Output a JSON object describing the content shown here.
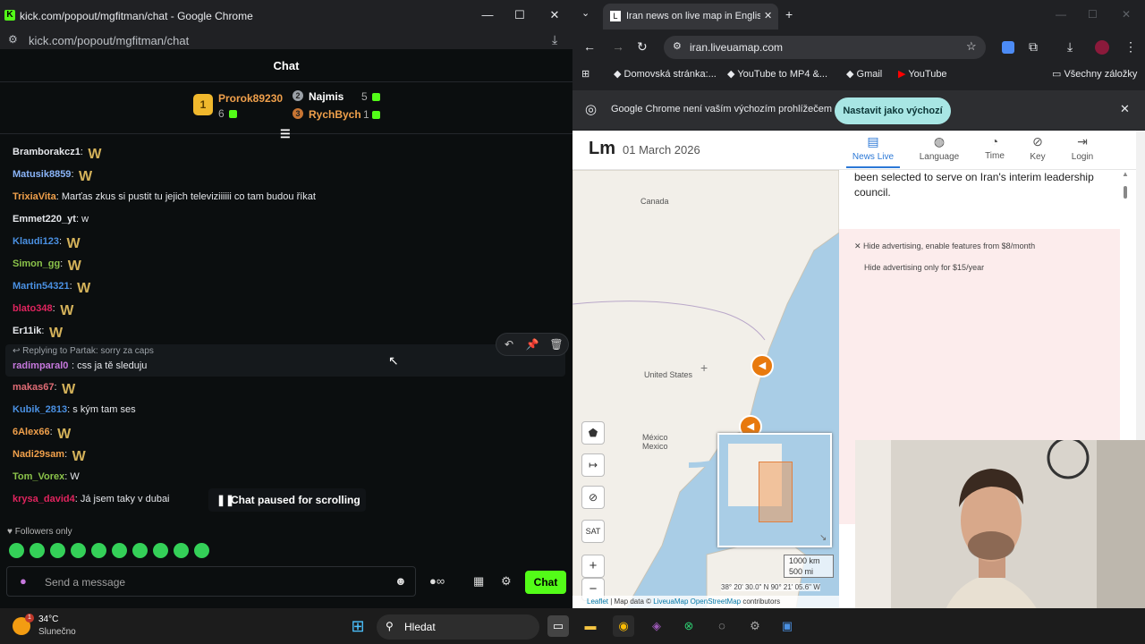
{
  "left_window": {
    "title": "kick.com/popout/mgfitman/chat - Google Chrome",
    "url": "kick.com/popout/mgfitman/chat",
    "chat_header": "Chat",
    "leaderboard": {
      "first": {
        "rank": "1",
        "name": "Prorok89230",
        "count": "6"
      },
      "second": {
        "rank": "2",
        "name": "Najmis",
        "count": "5"
      },
      "third": {
        "rank": "3",
        "name": "RychBych",
        "count": "1"
      }
    },
    "messages": [
      {
        "user": "Bramborakcz1",
        "color": "#e5e7eb",
        "text": ""
      },
      {
        "user": "Matusik8859",
        "color": "#8ab4f8",
        "text": ""
      },
      {
        "user": "TrixiaVita",
        "color": "#f0a04b",
        "text": "Marťas zkus si pustit tu jejich televiziiiiii co tam budou říkat"
      },
      {
        "user": "Emmet220_yt",
        "color": "#e5e7eb",
        "text": "w"
      },
      {
        "user": "Klaudi123",
        "color": "#4a90e2",
        "text": ""
      },
      {
        "user": "Simon_gg",
        "color": "#8bc34a",
        "text": ""
      },
      {
        "user": "Martin54321",
        "color": "#4a90e2",
        "text": ""
      },
      {
        "user": "blato348",
        "color": "#e0245e",
        "text": ""
      },
      {
        "user": "Er11ik",
        "color": "#e5e7eb",
        "text": ""
      }
    ],
    "reply": {
      "context": "Replying to Partak: sorry za caps",
      "user": "radimparal0",
      "text": "css ja tě sleduju"
    },
    "messages2": [
      {
        "user": "makas67",
        "color": "#e06c75",
        "text": ""
      },
      {
        "user": "Kubik_2813",
        "color": "#4a90e2",
        "text": "s kým tam ses"
      },
      {
        "user": "6Alex66",
        "color": "#f0a04b",
        "text": ""
      },
      {
        "user": "Nadi29sam",
        "color": "#f0a04b",
        "text": ""
      },
      {
        "user": "Tom_Vorex",
        "color": "#8bc34a",
        "text": "W"
      },
      {
        "user": "krysa_david4",
        "color": "#e0245e",
        "text": "Já jsem taky v dubai"
      }
    ],
    "paused": "Chat paused for scrolling",
    "followers": "Followers only",
    "send_placeholder": "Send a message",
    "chat_button": "Chat"
  },
  "right_window": {
    "tab_title": "Iran news on live map in English",
    "url": "iran.liveuamap.com",
    "bookmarks": [
      "Domovská stránka:...",
      "YouTube to MP4 &...",
      "Gmail",
      "YouTube"
    ],
    "all_bookmarks": "Všechny záložky",
    "infobar_text": "Google Chrome není vaším výchozím prohlížečem",
    "infobar_button": "Nastavit jako výchozí",
    "date": "01 March 2026",
    "nav": [
      "News Live",
      "Language",
      "Time",
      "Key",
      "Login"
    ],
    "article_text": "been selected to serve on Iran's interim leadership council.",
    "ad1": "Hide advertising, enable features from $8/month",
    "ad2": "Hide advertising only for $15/year",
    "map_labels": {
      "canada": "Canada",
      "us": "United States",
      "mexico": "México\nMexico"
    },
    "map_buttons": [
      "SAT",
      "+",
      "−"
    ],
    "scale": [
      "1000 km",
      "500 mi"
    ],
    "coords": "38° 20' 30.0\" N 90° 21' 05.6\" W",
    "attribution": {
      "leaflet": "Leaflet",
      "map_data": " | Map data © ",
      "liveuamap": "LiveuaMap",
      "osm": "OpenStreetMap",
      "contrib": " contributors"
    }
  },
  "taskbar": {
    "temp": "34°C",
    "weather": "Slunečno",
    "search": "Hledat",
    "badge": "1"
  }
}
